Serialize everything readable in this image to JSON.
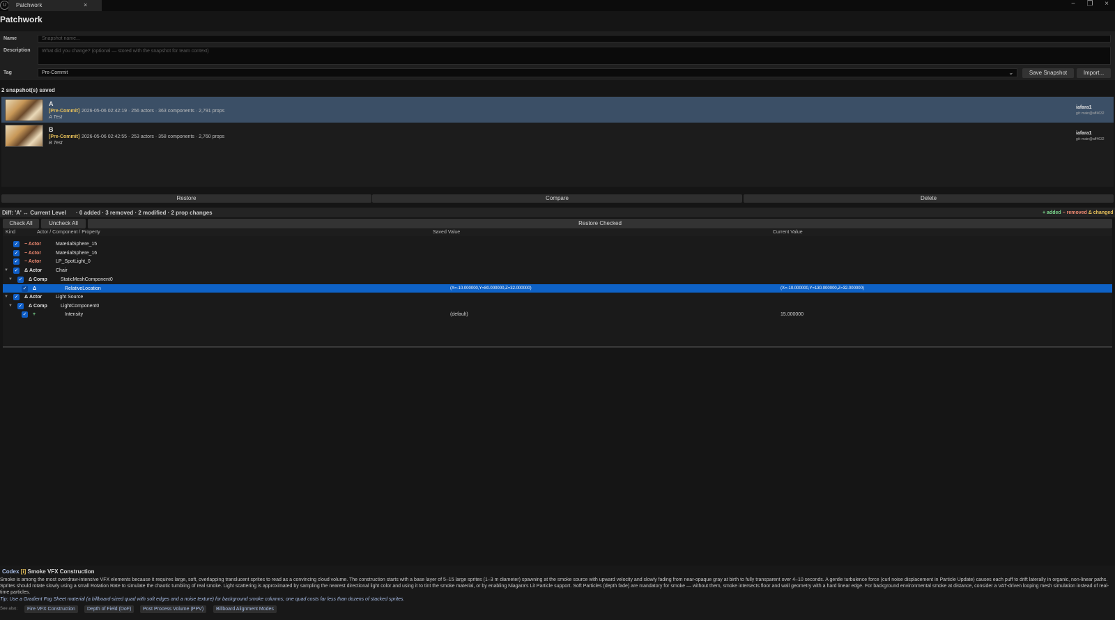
{
  "window": {
    "tab_label": "Patchwork",
    "close_glyph": "×",
    "logo": "U"
  },
  "panel": {
    "title": "Patchwork"
  },
  "form": {
    "name_label": "Name",
    "name_placeholder": "Snapshot name...",
    "description_label": "Description",
    "description_placeholder": "What did you change? (optional — stored with the snapshot for team context)",
    "tag_label": "Tag",
    "tag_value": "Pre-Commit",
    "save_label": "Save Snapshot",
    "import_label": "Import..."
  },
  "snapshots": {
    "count_label": "2 snapshot(s) saved",
    "items": [
      {
        "name": "A",
        "tag": "[Pre-Commit]",
        "meta": "2026-05-06 02:42:19 · 256 actors · 363 components · 2,791 props",
        "desc": "A Test",
        "user": "iafara1",
        "git": "git: main@aff4632"
      },
      {
        "name": "B",
        "tag": "[Pre-Commit]",
        "meta": "2026-05-06 02:42:55 · 253 actors · 358 components · 2,760 props",
        "desc": "B Test",
        "user": "iafara1",
        "git": "git: main@aff4632"
      }
    ]
  },
  "actions": {
    "restore": "Restore",
    "compare": "Compare",
    "delete": "Delete"
  },
  "diff": {
    "title": "Diff: 'A' ↔ Current Level",
    "summary": "·   0 added · 3 removed · 2 modified · 2 prop changes",
    "legend_added": "+ added",
    "legend_removed": "− removed",
    "legend_changed": "Δ changed",
    "check_all": "Check All",
    "uncheck_all": "Uncheck All",
    "restore_checked": "Restore Checked",
    "columns": {
      "kind": "Kind",
      "path": "Actor / Component / Property",
      "saved": "Saved Value",
      "current": "Current Value"
    },
    "rows": [
      {
        "kind": "− Actor",
        "name": "MaterialSphere_15",
        "saved": "",
        "current": ""
      },
      {
        "kind": "− Actor",
        "name": "MaterialSphere_16",
        "saved": "",
        "current": ""
      },
      {
        "kind": "− Actor",
        "name": "LP_SpotLight_0",
        "saved": "",
        "current": ""
      },
      {
        "kind": "Δ Actor",
        "name": "Chair",
        "saved": "",
        "current": ""
      },
      {
        "kind": "Δ Comp",
        "name": "StaticMeshComponent0",
        "saved": "",
        "current": ""
      },
      {
        "kind": "Δ",
        "name": "RelativeLocation",
        "saved": "(X=-10.000000,Y=80.000000,Z=32.000000)",
        "current": "(X=-10.000000,Y=130.000000,Z=32.000000)"
      },
      {
        "kind": "Δ Actor",
        "name": "Light Source",
        "saved": "",
        "current": ""
      },
      {
        "kind": "Δ Comp",
        "name": "LightComponent0",
        "saved": "",
        "current": ""
      },
      {
        "kind": "+",
        "name": "Intensity",
        "saved": "(default)",
        "current": "15.000000"
      }
    ]
  },
  "codex": {
    "label": "Codex",
    "badge": "[i]",
    "title": "Smoke VFX Construction",
    "body": "Smoke is among the most overdraw-intensive VFX elements because it requires large, soft, overlapping translucent sprites to read as a convincing cloud volume. The construction starts with a base layer of 5–15 large sprites (1–3 m diameter) spawning at the smoke source with upward velocity and slowly fading from near-opaque gray at birth to fully transparent over 4–10 seconds. A gentle turbulence force (curl noise displacement in Particle Update) causes each puff to drift laterally in organic, non-linear paths. Sprites should rotate slowly using a small Rotation Rate to simulate the chaotic tumbling of real smoke. Light scattering is approximated by sampling the nearest directional light color and using it to tint the smoke material, or by enabling Niagara's Lit Particle support. Soft Particles (depth fade) are mandatory for smoke — without them, smoke intersects floor and wall geometry with a hard linear edge. For background environmental smoke at distance, consider a VAT-driven looping mesh simulation instead of real-time particles.",
    "tip": "Tip: Use a Gradient Fog Sheet material (a billboard-sized quad with soft edges and a noise texture) for background smoke columns; one quad costs far less than dozens of stacked sprites.",
    "see_also_label": "See also:",
    "see_also": [
      "Fire VFX Construction",
      "Depth of Field (DoF)",
      "Post Process Volume (PPV)",
      "Billboard Alignment Modes"
    ]
  },
  "colors": {
    "selection": "#0e62c7",
    "snapshot_selected": "#3b4f66",
    "removed": "#f08a72",
    "added": "#7bd68e",
    "changed": "#e8c15a",
    "tag": "#e8c15a"
  },
  "icons": {
    "check": "✓",
    "tri_down": "▼",
    "chevron": "⌄"
  }
}
